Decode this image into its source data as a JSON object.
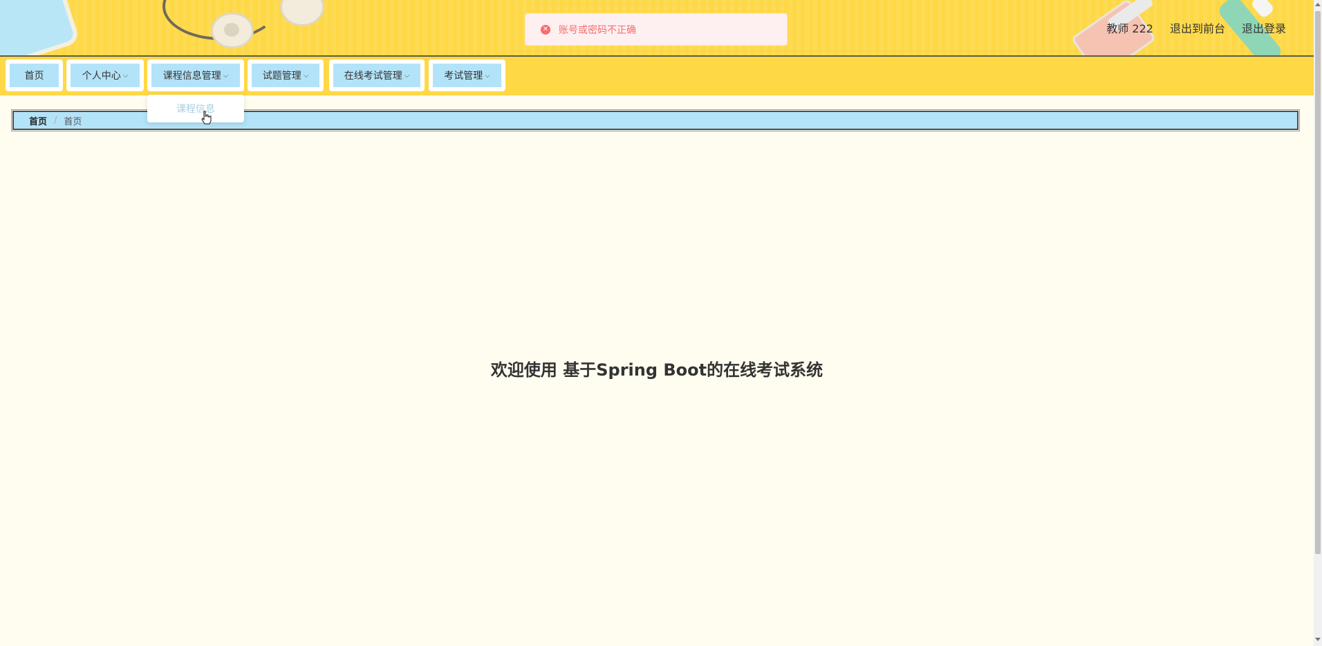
{
  "toast": {
    "message": "账号或密码不正确",
    "icon": "close-circle-icon",
    "color": "#f56c6c"
  },
  "user": {
    "name": "教师 222",
    "to_frontend": "退出到前台",
    "logout": "退出登录"
  },
  "nav": {
    "items": [
      {
        "label": "首页",
        "has_dropdown": false
      },
      {
        "label": "个人中心",
        "has_dropdown": true
      },
      {
        "label": "课程信息管理",
        "has_dropdown": true
      },
      {
        "label": "试题管理",
        "has_dropdown": true
      },
      {
        "label": "在线考试管理",
        "has_dropdown": true
      },
      {
        "label": "考试管理",
        "has_dropdown": true
      }
    ],
    "chevron": "⌵"
  },
  "dropdown": {
    "items": [
      {
        "label": "课程信息"
      }
    ]
  },
  "breadcrumb": {
    "first": "首页",
    "separator": "/",
    "second": "首页"
  },
  "welcome": {
    "title": "欢迎使用 基于Spring Boot的在线考试系统"
  },
  "colors": {
    "header_bg": "#fed845",
    "nav_item_bg": "#b3e3f8",
    "page_bg": "#fffdf0"
  }
}
